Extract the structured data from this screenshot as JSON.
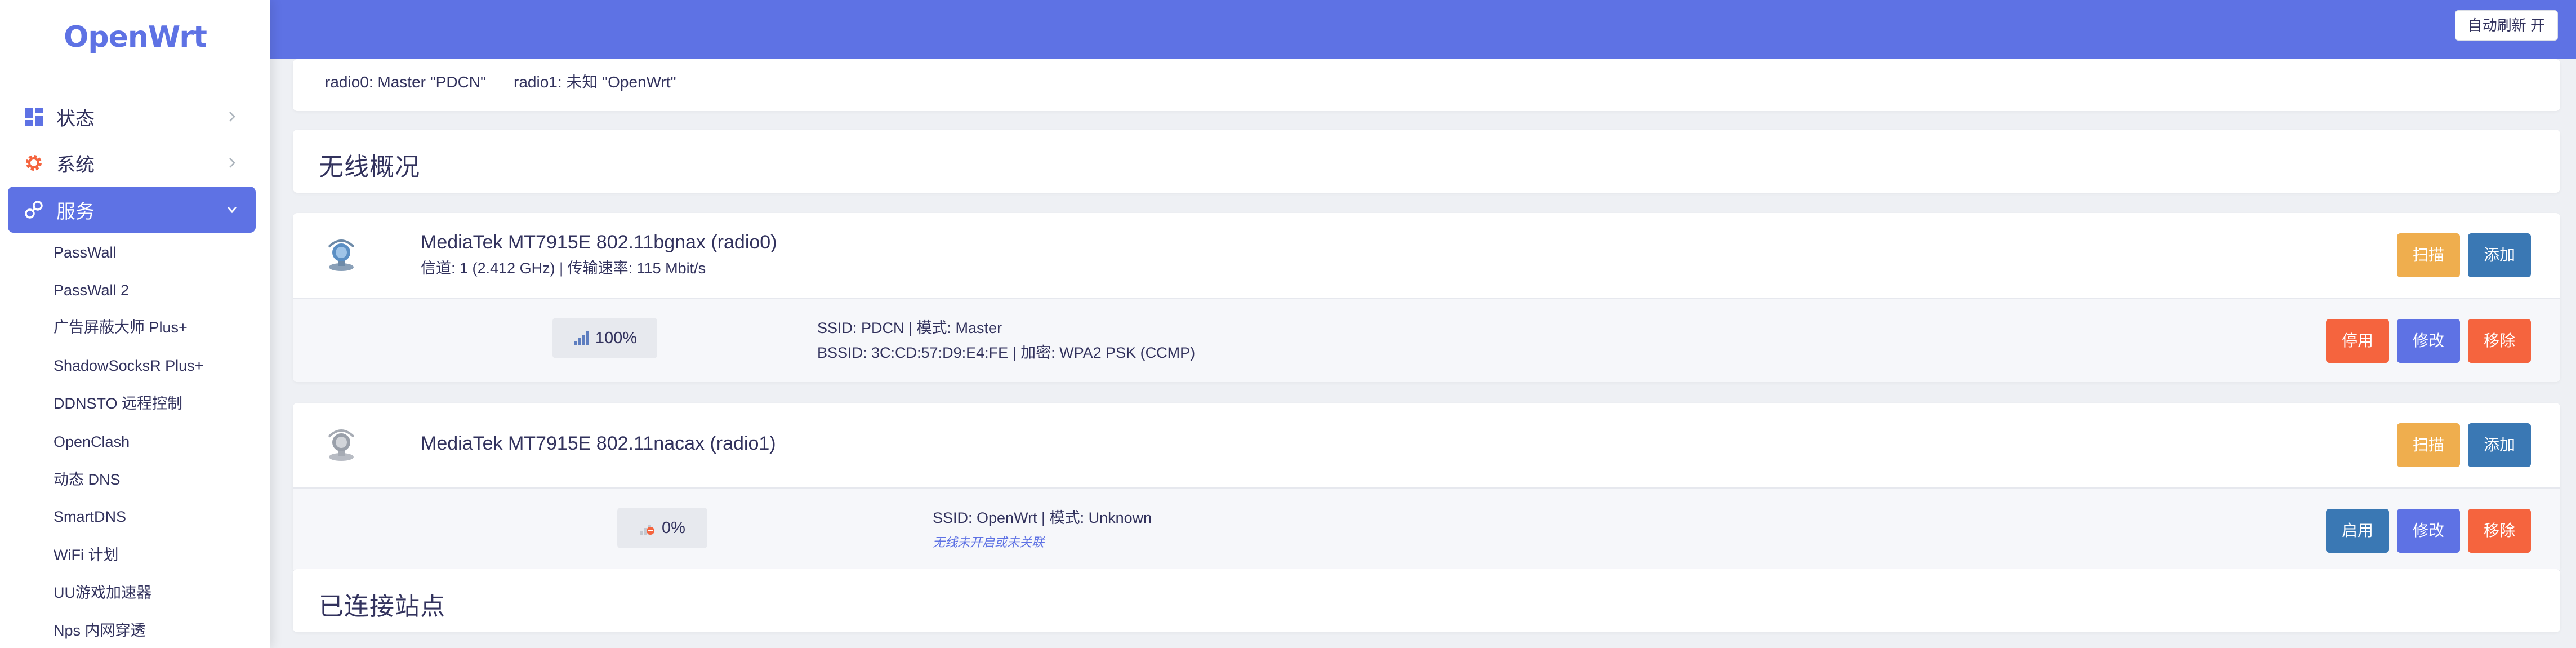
{
  "app": {
    "logo": "OpenWrt"
  },
  "header": {
    "auto_refresh": "自动刷新 开"
  },
  "sidebar": {
    "menu": [
      {
        "label": "状态",
        "icon": "dashboard-icon"
      },
      {
        "label": "系统",
        "icon": "gear-icon"
      },
      {
        "label": "服务",
        "icon": "services-icon",
        "active": true
      }
    ],
    "sub_items": [
      "PassWall",
      "PassWall 2",
      "广告屏蔽大师 Plus+",
      "ShadowSocksR Plus+",
      "DDNSTO 远程控制",
      "OpenClash",
      "动态 DNS",
      "SmartDNS",
      "WiFi 计划",
      "UU游戏加速器",
      "Nps 内网穿透"
    ]
  },
  "tabs": [
    "radio0: Master \"PDCN\"",
    "radio1: 未知 \"OpenWrt\""
  ],
  "wireless_overview": {
    "title": "无线概况",
    "radios": [
      {
        "name": "MediaTek MT7915E 802.11bgnax (radio0)",
        "details": "信道: 1 (2.412 GHz) | 传输速率: 115 Mbit/s",
        "scan_label": "扫描",
        "add_label": "添加",
        "signal": "100%",
        "signal_percent": 100,
        "ssid_line": "SSID: PDCN | 模式: Master",
        "bssid_line": "BSSID: 3C:CD:57:D9:E4:FE | 加密: WPA2 PSK (CCMP)",
        "toggle_label": "停用",
        "edit_label": "修改",
        "remove_label": "移除",
        "toggle_color": "#f5643e"
      },
      {
        "name": "MediaTek MT7915E 802.11nacax (radio1)",
        "details": "",
        "scan_label": "扫描",
        "add_label": "添加",
        "signal": "0%",
        "signal_percent": 0,
        "ssid_line": "SSID: OpenWrt | 模式: Unknown",
        "note": "无线未开启或未关联",
        "toggle_label": "启用",
        "edit_label": "修改",
        "remove_label": "移除",
        "toggle_color": "#3a78b4"
      }
    ]
  },
  "stations": {
    "title": "已连接站点"
  }
}
